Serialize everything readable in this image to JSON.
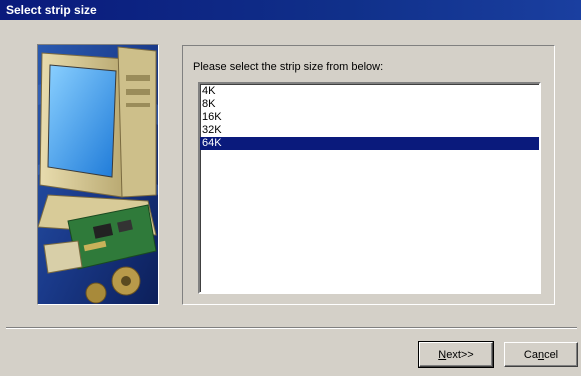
{
  "window": {
    "title": "Select strip size"
  },
  "main": {
    "prompt": "Please select the strip size from below:",
    "strip_sizes": [
      {
        "label": "4K",
        "selected": false
      },
      {
        "label": "8K",
        "selected": false
      },
      {
        "label": "16K",
        "selected": false
      },
      {
        "label": "32K",
        "selected": false
      },
      {
        "label": "64K",
        "selected": true
      }
    ]
  },
  "buttons": {
    "next": {
      "mnemonic": "N",
      "rest": "ext>>"
    },
    "cancel": {
      "pre": "Ca",
      "mnemonic": "n",
      "rest": "cel"
    }
  },
  "colors": {
    "titlebar": "#0a1a7c",
    "selection": "#0a1a7c",
    "face": "#d4d0c8"
  }
}
